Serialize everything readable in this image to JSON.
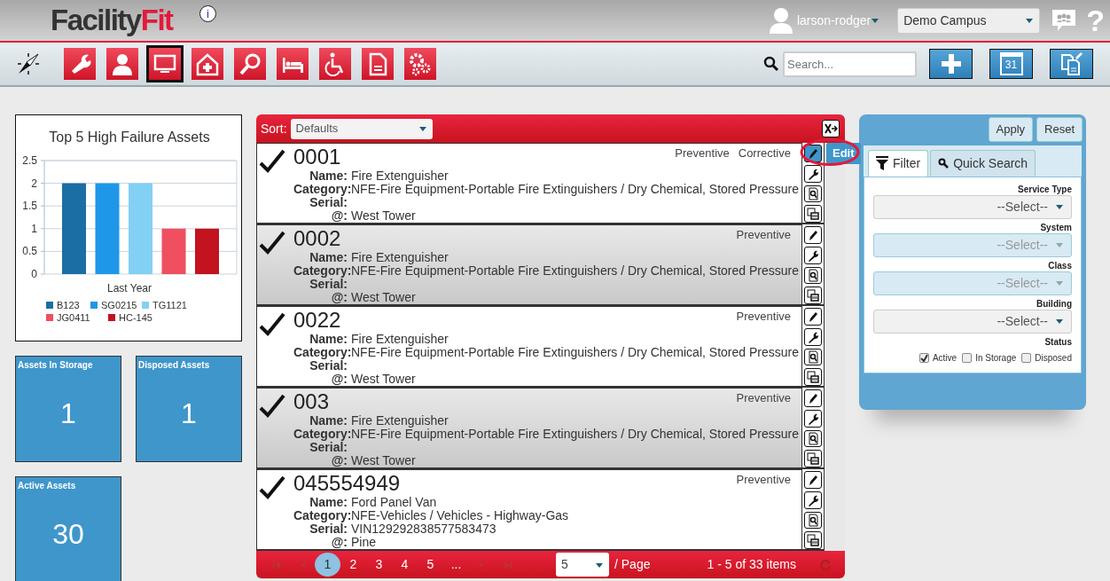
{
  "header": {
    "logo_dark": "Facility",
    "logo_red": "Fit",
    "info": "i",
    "user": "larson-rodger",
    "campus": "Demo Campus",
    "help": "?"
  },
  "toolbar": {
    "modules": [
      {
        "kind": "wrench",
        "selected": false
      },
      {
        "kind": "person",
        "selected": false
      },
      {
        "kind": "monitor",
        "selected": true
      },
      {
        "kind": "house",
        "selected": false
      },
      {
        "kind": "magnifier",
        "selected": false
      },
      {
        "kind": "bed",
        "selected": false
      },
      {
        "kind": "wheelchair",
        "selected": false
      },
      {
        "kind": "document",
        "selected": false
      },
      {
        "kind": "gears",
        "selected": false
      }
    ],
    "search": {
      "placeholder": "Search..."
    },
    "calendar_day": "31"
  },
  "chart": {
    "chart_data": {
      "type": "bar",
      "title": "Top 5 High Failure Assets",
      "xlabel": "Last Year",
      "grid": true,
      "legend": "bottom",
      "ylim": [
        0,
        2.5
      ],
      "yticks": [
        0,
        0.5,
        1,
        1.5,
        2,
        2.5
      ],
      "series": [
        {
          "name": "B123",
          "color": "#1b6ea3",
          "values": [
            2
          ]
        },
        {
          "name": "SG0215",
          "color": "#1f97e8",
          "values": [
            2
          ]
        },
        {
          "name": "TG1121",
          "color": "#83d0f5",
          "values": [
            2
          ]
        },
        {
          "name": "JG0411",
          "color": "#ef4f5f",
          "values": [
            1
          ]
        },
        {
          "name": "HC-145",
          "color": "#c2131f",
          "values": [
            1
          ]
        }
      ]
    }
  },
  "tiles": [
    {
      "label": "Assets In Storage",
      "value": "1"
    },
    {
      "label": "Disposed Assets",
      "value": "1"
    },
    {
      "label": "Active Assets",
      "value": "30"
    }
  ],
  "list": {
    "sort_label": "Sort:",
    "sort_value": "Defaults",
    "tooltip": "Edit",
    "rows": [
      {
        "number": "0001",
        "tags": [
          "Preventive",
          "Corrective"
        ],
        "edit_hovered": true,
        "fields": [
          {
            "label": "Name:",
            "value": "Fire Extenguisher"
          },
          {
            "label": "Category:",
            "value": "NFE-Fire Equipment-Portable Fire Extinguishers / Dry Chemical, Stored Pressure"
          },
          {
            "label": "Serial:"
          },
          {
            "label": "@:",
            "value": "West Tower"
          }
        ]
      },
      {
        "number": "0002",
        "tags": [
          "Preventive"
        ],
        "edit_hovered": false,
        "fields": [
          {
            "label": "Name:",
            "value": "Fire Extenguisher"
          },
          {
            "label": "Category:",
            "value": "NFE-Fire Equipment-Portable Fire Extinguishers / Dry Chemical, Stored Pressure"
          },
          {
            "label": "Serial:"
          },
          {
            "label": "@:",
            "value": "West Tower"
          }
        ]
      },
      {
        "number": "0022",
        "tags": [
          "Preventive"
        ],
        "edit_hovered": false,
        "fields": [
          {
            "label": "Name:",
            "value": "Fire Extenguisher"
          },
          {
            "label": "Category:",
            "value": "NFE-Fire Equipment-Portable Fire Extinguishers / Dry Chemical, Stored Pressure"
          },
          {
            "label": "Serial:"
          },
          {
            "label": "@:",
            "value": "West Tower"
          }
        ]
      },
      {
        "number": "003",
        "tags": [
          "Preventive"
        ],
        "edit_hovered": false,
        "fields": [
          {
            "label": "Name:",
            "value": "Fire Extenguisher"
          },
          {
            "label": "Category:",
            "value": "NFE-Fire Equipment-Portable Fire Extinguishers / Dry Chemical, Stored Pressure"
          },
          {
            "label": "Serial:"
          },
          {
            "label": "@:",
            "value": "West Tower"
          }
        ]
      },
      {
        "number": "045554949",
        "tags": [
          "Preventive"
        ],
        "edit_hovered": false,
        "fields": [
          {
            "label": "Name:",
            "value": "Ford Panel Van"
          },
          {
            "label": "Category:",
            "value": "NFE-Vehicles / Vehicles - Highway-Gas"
          },
          {
            "label": "Serial:",
            "value": "VIN129292838577583473"
          },
          {
            "label": "@:",
            "value": "Pine"
          }
        ]
      }
    ],
    "pages": [
      {
        "label": "1",
        "selected": true
      },
      {
        "label": "2",
        "selected": false
      },
      {
        "label": "3",
        "selected": false
      },
      {
        "label": "4",
        "selected": false
      },
      {
        "label": "5",
        "selected": false
      },
      {
        "label": "...",
        "selected": false
      }
    ],
    "page_size": "5",
    "page_suffix": "/ Page",
    "count": "1 - 5 of 33 items"
  },
  "filter": {
    "buttons": [
      "Apply",
      "Reset"
    ],
    "tabs": [
      {
        "label": "Filter",
        "kind": "filter",
        "selected": true
      },
      {
        "label": "Quick Search",
        "kind": "search",
        "selected": false
      }
    ],
    "fields": [
      {
        "label": "Service Type",
        "placeholder": "--Select--",
        "disabled": false
      },
      {
        "label": "System",
        "placeholder": "--Select--",
        "disabled": true
      },
      {
        "label": "Class",
        "placeholder": "--Select--",
        "disabled": true
      },
      {
        "label": "Building",
        "placeholder": "--Select--",
        "disabled": false
      }
    ],
    "status_label": "Status",
    "statuses": [
      {
        "label": "Active",
        "checked": true
      },
      {
        "label": "In Storage",
        "checked": false
      },
      {
        "label": "Disposed",
        "checked": false
      }
    ]
  }
}
